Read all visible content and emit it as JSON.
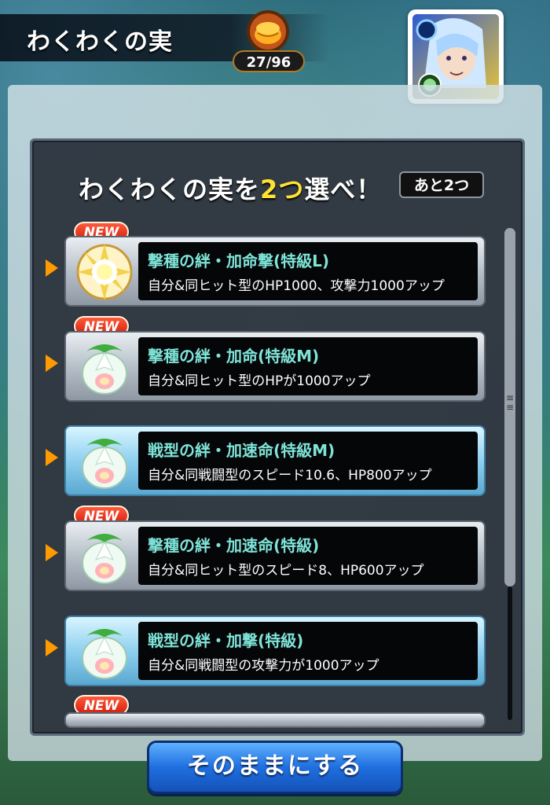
{
  "header": {
    "title": "わくわくの実",
    "fruit_counter": "27/96"
  },
  "panel": {
    "prompt_before": "わくわくの実を",
    "prompt_highlight": "2つ",
    "prompt_after": "選べ！",
    "remaining": "あと2つ"
  },
  "items": [
    {
      "name": "撃種の絆・加命撃(特級L)",
      "desc": "自分&同ヒット型のHP1000、攻撃力1000アップ",
      "new": "NEW",
      "icon": "golden-fruit-icon"
    },
    {
      "name": "撃種の絆・加命(特級M)",
      "desc": "自分&同ヒット型のHPが1000アップ",
      "new": "NEW",
      "icon": "white-fruit-icon"
    },
    {
      "name": "戦型の絆・加速命(特級M)",
      "desc": "自分&同戦闘型のスピード10.6、HP800アップ",
      "new": "",
      "icon": "white-fruit-icon"
    },
    {
      "name": "撃種の絆・加速命(特級)",
      "desc": "自分&同ヒット型のスピード8、HP600アップ",
      "new": "NEW",
      "icon": "white-fruit-icon"
    },
    {
      "name": "戦型の絆・加撃(特級)",
      "desc": "自分&同戦闘型の攻撃力が1000アップ",
      "new": "",
      "icon": "white-fruit-icon"
    }
  ],
  "partial_item": {
    "new": "NEW"
  },
  "keep_button": "そのままにする",
  "colors": {
    "accent_yellow": "#ffe233",
    "item_name_teal": "#7fe4d8",
    "arrow_orange": "#ff9a00",
    "button_blue": "#1f6fe0"
  }
}
